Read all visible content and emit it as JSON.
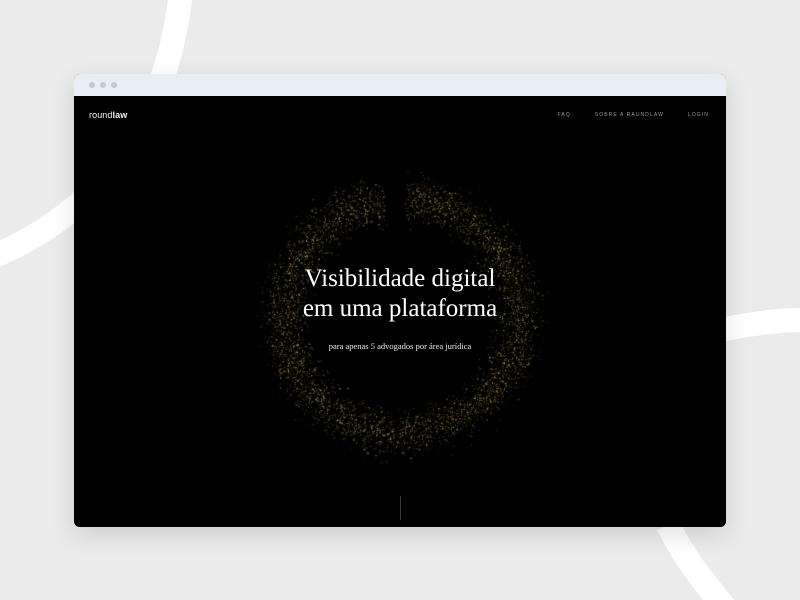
{
  "brand": {
    "logo_light": "round",
    "logo_bold": "law"
  },
  "nav": {
    "items": [
      "FAQ",
      "SOBRE A RAUNDLAW",
      "LOGIN"
    ]
  },
  "hero": {
    "headline_line1": "Visibilidade digital",
    "headline_line2": "em uma plataforma",
    "subtitle": "para apenas 5 advogados por área jurídica"
  },
  "colors": {
    "page_background": "#ebebeb",
    "browser_bar": "#e9edf6",
    "site_background": "#000000",
    "particle_gold": "#c9a03a",
    "particle_pale": "#e2cf8a"
  }
}
